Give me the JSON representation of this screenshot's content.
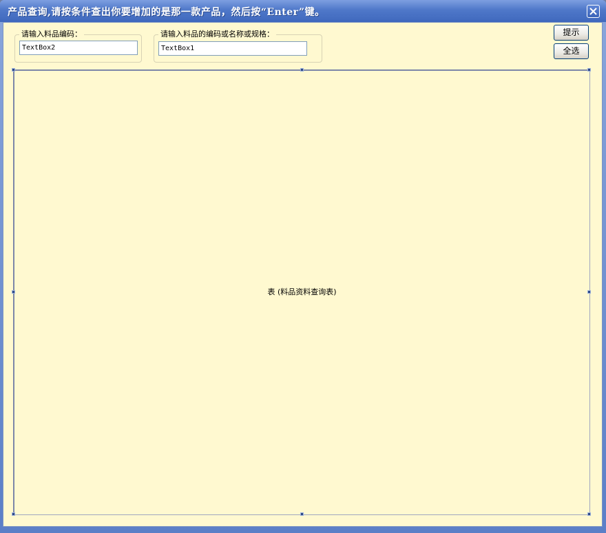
{
  "window": {
    "title": "产品查询,请按条件查出你要增加的是那一款产品，然后按“Enter”键。"
  },
  "group_code": {
    "legend": "请输入料品编码：",
    "textbox_value": "TextBox2"
  },
  "group_spec": {
    "legend": "请输入料品的编码或名称或规格：",
    "textbox_value": "TextBox1"
  },
  "buttons": {
    "hint_label": "提示",
    "select_all_label": "全选"
  },
  "table": {
    "caption": "表 (料品资料查询表)"
  },
  "icons": {
    "close": "close-icon"
  },
  "colors": {
    "client_background": "#fff9d0",
    "titlebar": "#4f78c9"
  }
}
